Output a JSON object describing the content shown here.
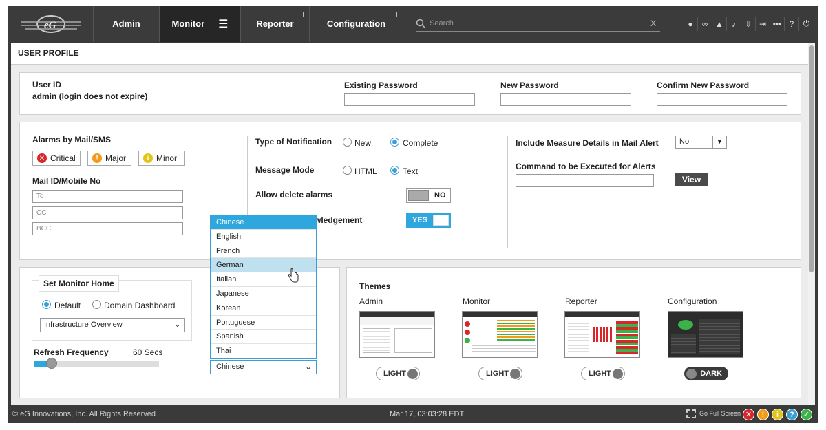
{
  "nav": {
    "logo_text": "eG",
    "tabs": [
      "Admin",
      "Monitor",
      "Reporter",
      "Configuration"
    ],
    "search_placeholder": "Search",
    "search_clear": "X"
  },
  "page": {
    "title": "USER PROFILE"
  },
  "account": {
    "user_id_label": "User ID",
    "user_id_value": "admin (login does not expire)",
    "existing_password_label": "Existing Password",
    "new_password_label": "New Password",
    "confirm_password_label": "Confirm New Password"
  },
  "alarms": {
    "title": "Alarms by Mail/SMS",
    "critical": "Critical",
    "major": "Major",
    "minor": "Minor",
    "mail_label": "Mail ID/Mobile No",
    "to_placeholder": "To",
    "cc_placeholder": "CC",
    "bcc_placeholder": "BCC"
  },
  "notification": {
    "type_label": "Type of Notification",
    "type_new": "New",
    "type_complete": "Complete",
    "mode_label": "Message Mode",
    "mode_html": "HTML",
    "mode_text": "Text",
    "allow_delete_label": "Allow delete alarms",
    "allow_delete_value": "NO",
    "ack_label": "wledgement",
    "ack_value": "YES"
  },
  "mail_alert": {
    "include_label": "Include Measure Details in Mail Alert",
    "include_value": "No",
    "command_label": "Command to be Executed for Alerts",
    "view_button": "View"
  },
  "language_dropdown": {
    "options": [
      "Chinese",
      "English",
      "French",
      "German",
      "Italian",
      "Japanese",
      "Korean",
      "Portuguese",
      "Spanish",
      "Thai"
    ],
    "selected": "Chinese",
    "hover": "German"
  },
  "monitor_home": {
    "title": "Set Monitor Home",
    "option_default": "Default",
    "option_domain": "Domain Dashboard",
    "selected_view": "Infrastructure Overview",
    "refresh_label": "Refresh Frequency",
    "refresh_value": "60 Secs",
    "refresh_slider_fraction": 0.1
  },
  "themes": {
    "title": "Themes",
    "items": [
      {
        "name": "Admin",
        "mode": "LIGHT"
      },
      {
        "name": "Monitor",
        "mode": "LIGHT"
      },
      {
        "name": "Reporter",
        "mode": "LIGHT"
      },
      {
        "name": "Configuration",
        "mode": "DARK"
      }
    ]
  },
  "footer": {
    "copyright": "© eG Innovations, Inc. All Rights Reserved",
    "datetime": "Mar 17, 03:03:28 EDT",
    "fullscreen": "Go Full Screen"
  },
  "colors": {
    "accent": "#2ea7de",
    "critical": "#d9262b",
    "major": "#f39a1a",
    "minor": "#e4c31a",
    "info": "#3b9fd6",
    "ok": "#3bb34a"
  }
}
